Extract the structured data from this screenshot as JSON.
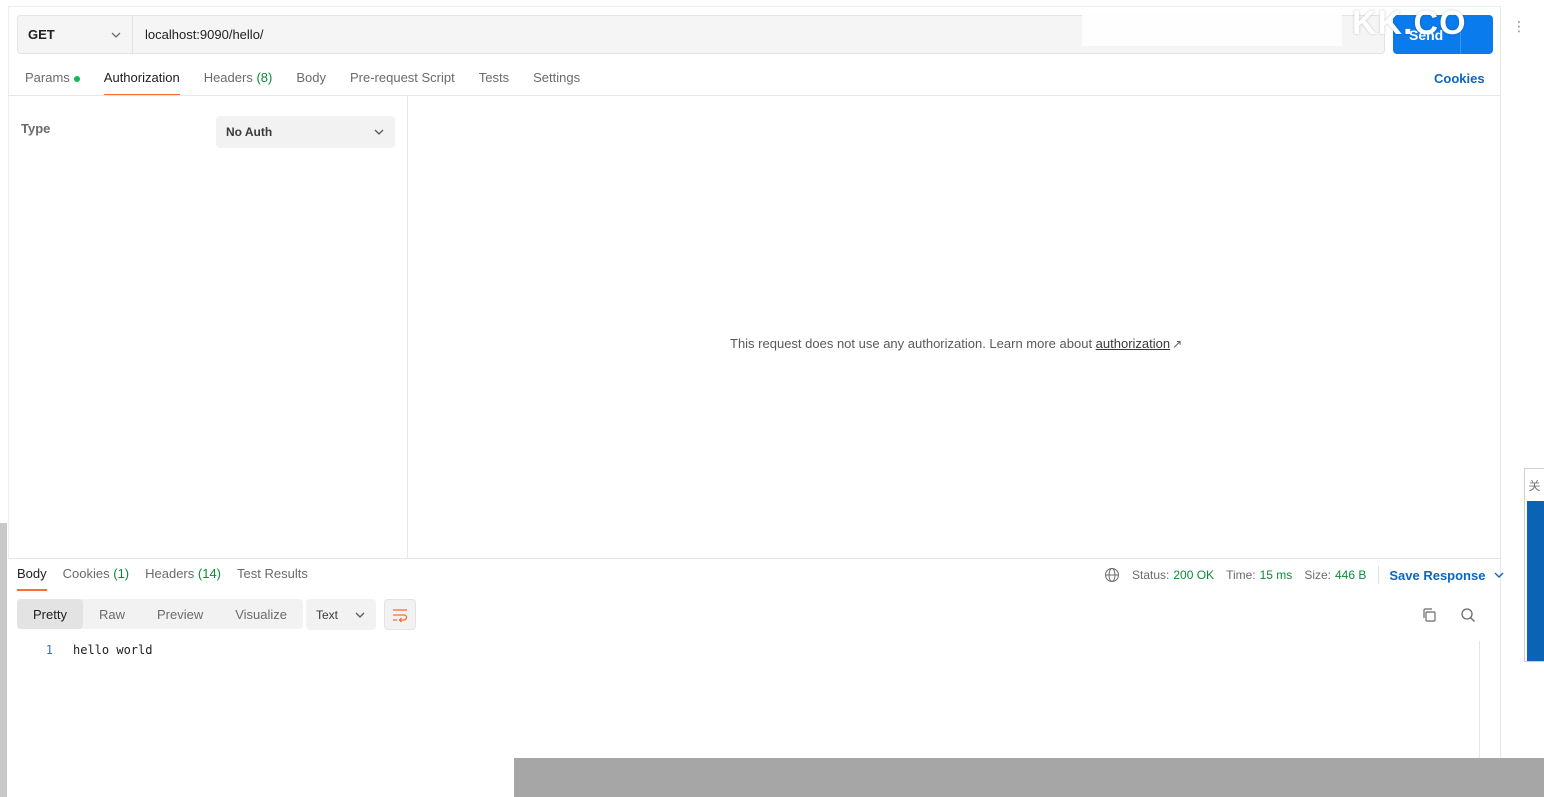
{
  "request": {
    "method": "GET",
    "url": "localhost:9090/hello/",
    "send_label": "Send",
    "watermark": "KK.CO",
    "tabs": [
      {
        "label": "Params",
        "count": ""
      },
      {
        "label": "Authorization",
        "count": ""
      },
      {
        "label": "Headers",
        "count": "(8)"
      },
      {
        "label": "Body",
        "count": ""
      },
      {
        "label": "Pre-request Script",
        "count": ""
      },
      {
        "label": "Tests",
        "count": ""
      },
      {
        "label": "Settings",
        "count": ""
      }
    ],
    "cookies_label": "Cookies"
  },
  "auth": {
    "type_label": "Type",
    "type_value": "No Auth",
    "message": "This request does not use any authorization. Learn more about ",
    "link_text": "authorization",
    "link_arrow": "↗"
  },
  "response": {
    "tabs": [
      {
        "label": "Body",
        "count": ""
      },
      {
        "label": "Cookies",
        "count": "(1)"
      },
      {
        "label": "Headers",
        "count": "(14)"
      },
      {
        "label": "Test Results",
        "count": ""
      }
    ],
    "status_label": "Status:",
    "status_value": "200 OK",
    "time_label": "Time:",
    "time_value": "15 ms",
    "size_label": "Size:",
    "size_value": "446 B",
    "save_label": "Save Response",
    "formats": [
      "Pretty",
      "Raw",
      "Preview",
      "Visualize"
    ],
    "language": "Text",
    "lines": [
      {
        "number": "1",
        "text": "hello world"
      }
    ]
  },
  "side_panel": {
    "label": "关"
  },
  "colors": {
    "accent_orange": "#ff6c37",
    "send_blue": "#097bed",
    "link_blue": "#0a66c2",
    "status_green": "#0c8a3a"
  },
  "icons": {
    "method_dropdown": "chevron-down-icon",
    "globe": "globe-icon",
    "copy": "copy-icon",
    "search": "search-icon",
    "wrap": "wrap-lines-icon"
  }
}
